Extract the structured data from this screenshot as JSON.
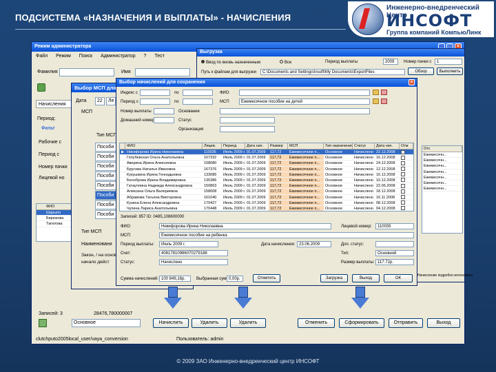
{
  "slide": {
    "title": "ПОДСИСТЕМА «НАЗНАЧЕНИЯ И ВЫПЛАТЫ» - НАЧИСЛЕНИЯ",
    "footer": "© 2009 ЗАО Инженерно-внедренческий центр ИНСОФТ"
  },
  "logo": {
    "top": "Инженерно-внедренческий Центр",
    "brand": "ИНСОФТ",
    "sub": "Группа компаний КомпьюЛинк"
  },
  "main": {
    "title": "Режим администратора",
    "menu": [
      "Файл",
      "Режим",
      "Поиск",
      "Администратор",
      "?",
      "Тест"
    ],
    "surname_label": "Фамилия",
    "name_label": "Имя",
    "tab": "Начисления",
    "period_label": "Период:",
    "filter": "Фильт",
    "side_labels": [
      "Рабочие с",
      "Период с",
      "Номер пачки",
      "Лицевой но"
    ],
    "small_grid_header": "ФИО",
    "small_grid_rows": [
      "Шарыпо",
      "Бирюкова",
      "Тагилова"
    ],
    "records": "Записей: 3",
    "total": "28476,780000007",
    "bottom_select": "Основное",
    "buttons": [
      "Начислить",
      "Удалить",
      "Удалить",
      "Отменить",
      "Сформировать",
      "Отправить",
      "Выход"
    ],
    "status_path": "clutchputo2005local_user/vaya_conversion",
    "status_user": "Пользователь: admin"
  },
  "mcp": {
    "title": "Выбор МСП для",
    "date_label": "Дата",
    "date_day": "22",
    "date_mon": "Ле",
    "list_label": "МСП",
    "type_label": "Тип МСП",
    "items": [
      "Пособи",
      "Пособи",
      "Пособи",
      "Пособи",
      "Пособи",
      "Пособи",
      "Пособи",
      "Пособи"
    ],
    "type_value": "Тип МСП",
    "name_label": "Наименовани",
    "note1": "Закон, / на основании",
    "note2": "начало дейст"
  },
  "upload": {
    "title": "Выгрузка",
    "opt1": "Ввод по вновь назначенным",
    "opt2": "Все",
    "period_label": "Период выплаты",
    "year": "2009",
    "pack_label": "Номер пачки с",
    "pack": "1",
    "path_label": "Путь к файлам для выгрузки",
    "path": "C:\\Documents and Settings\\Insoft\\My Documents\\ExportFiles",
    "btn_browse": "Обзор",
    "btn_run": "Выполнить"
  },
  "select": {
    "title": "Выбор начислений для сохранения",
    "f_inn": "Индекс с",
    "f_to": "по",
    "f_period": "Период с",
    "f_fio": "ФИО",
    "f_msp": "МСП",
    "msp_value": "Ежемесячное пособие на детей",
    "f_pack": "Номер выплаты",
    "f_cause": "Основание",
    "f_status": "Статус",
    "f_org": "Организация",
    "f_code": "Домашний номер",
    "columns": [
      "ФИО",
      "Лицев.",
      "Период",
      "Дата нач.",
      "Размер",
      "МСП",
      "Тип назначения",
      "Статус",
      "Дата нач.",
      "Отм"
    ],
    "rows": [
      [
        "Никифорова Ирина Николаевна",
        "110035",
        "Июль 2009 г.",
        "01.07.2009",
        "117,72",
        "Ежемесячное п...",
        "Основное",
        "Начислено",
        "22.12.2008"
      ],
      [
        "Голубевская Ольга Анатольевна",
        "167332",
        "Июль 2009 г.",
        "01.07.2009",
        "117,72",
        "Ежемесячное п...",
        "Основное",
        "Начислено",
        "16.12.2008"
      ],
      [
        "Аверина Ирина Алексеевна",
        "158080",
        "Июль 2009 г.",
        "01.07.2009",
        "117,72",
        "Ежемесячное п...",
        "Основное",
        "Начислено",
        "24.12.2008"
      ],
      [
        "Брусова Наталья Ивановна",
        "167376",
        "Июль 2009 г.",
        "01.07.2009",
        "117,72",
        "Ежемесячное п...",
        "Основное",
        "Начислено",
        "12.12.2008"
      ],
      [
        "Кукушкина Ирина Геннадьевна",
        "133085",
        "Июль 2009 г.",
        "01.07.2009",
        "117,72",
        "Ежемесячное п...",
        "Основное",
        "Начислено",
        "16.12.2008"
      ],
      [
        "Белоброва Ирина Владимировна",
        "135386",
        "Июль 2009 г.",
        "01.07.2009",
        "117,72",
        "Ежемесячное п...",
        "Основное",
        "Начислено",
        "10.12.2008"
      ],
      [
        "Гатауллина Надежда Александровна",
        "150863",
        "Июль 2009 г.",
        "01.07.2009",
        "117,72",
        "Ежемесячное п...",
        "Основное",
        "Начислено",
        "22.06.2008"
      ],
      [
        "Алексина Ольга Валериевна",
        "158008",
        "Июль 2009 г.",
        "01.07.2009",
        "117,72",
        "Ежемесячное п...",
        "Основное",
        "Начислено",
        "18.12.2008"
      ],
      [
        "Абрамова Татьяна Викторовна",
        "161040",
        "Июль 2009 г.",
        "01.07.2009",
        "117,72",
        "Ежемесячное п...",
        "Основное",
        "Начислено",
        "16.11.2008"
      ],
      [
        "Кузина Елена Александровна",
        "170427",
        "Июль 2009 г.",
        "01.07.2009",
        "117,72",
        "Ежемесячное п...",
        "Основное",
        "Начислено",
        "08.12.2008"
      ],
      [
        "Чупина Лариса Анатольевна",
        "170448",
        "Июль 2009 г.",
        "01.07.2009",
        "117,72",
        "Ежемесячное п...",
        "Основное",
        "Начислено",
        "04.12.2008"
      ]
    ],
    "records": "Записей: 857",
    "rec_id": "ID: 0485,108600000",
    "d_fio": "ФИО:",
    "d_fio_v": "Никифорова Ирина Николаевна",
    "d_acc": "Лицевой номер:",
    "d_acc_v": "110035",
    "d_msp": "МСП:",
    "d_msp_v": "Ежемесячное пособие на ребенка",
    "d_period": "Период выплаты:",
    "d_period_v": "Июль 2009 г.",
    "d_date": "Дата начисления:",
    "d_date_v": "23.06.2009",
    "d_st": "Доп. статус:",
    "d_sch": "Счет:",
    "d_sch_v": "40817810986070279188",
    "d_type": "Тип:",
    "d_type_v": "Основной",
    "d_status": "Статус:",
    "d_status_v": "Начислено",
    "d_size": "Размер выплаты:",
    "d_size_v": "117.72р.",
    "sum_label": "Сумма начислений:",
    "sum": "100 849,16р.",
    "sum2_label": "Выбранная сумма:",
    "sum2": "0,00р.",
    "btn_mark": "Отметить",
    "btn_load": "Загрузка",
    "btn_close": "Выход",
    "btn_ok": "ОК",
    "right_col": [
      "Отс",
      "Ежемесячн...",
      "Ежемесячн...",
      "Ежемесячн...",
      "Ежемесячн...",
      "Ежемесячн...",
      "Ежемесячн...",
      "Ежемесячн..."
    ],
    "right_note": "Начисление подробно интенсивно"
  }
}
